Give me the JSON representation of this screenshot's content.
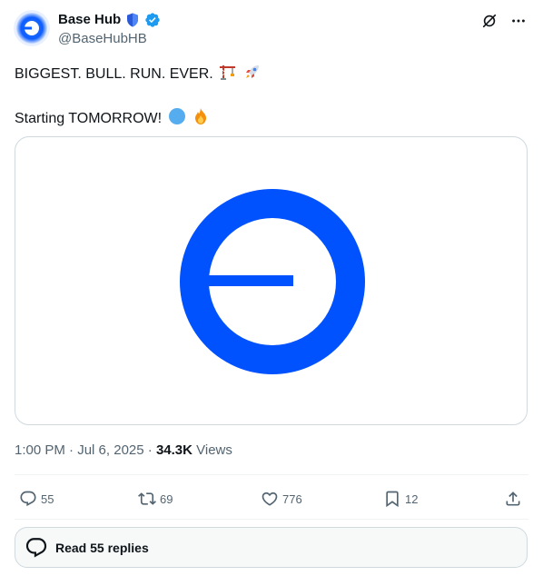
{
  "author": {
    "display_name": "Base Hub",
    "handle": "@BaseHubHB"
  },
  "tweet": {
    "line1": "BIGGEST. BULL. RUN. EVER.",
    "line1_emojis": [
      "crane-emoji",
      "rocket-emoji"
    ],
    "line2": "Starting TOMORROW!",
    "line2_emojis": [
      "blue-circle-emoji",
      "fire-emoji"
    ]
  },
  "meta": {
    "time": "1:00 PM",
    "sep1": " · ",
    "date": "Jul 6, 2025",
    "sep2": " · ",
    "views_count": "34.3K",
    "views_label": " Views"
  },
  "actions": {
    "replies": "55",
    "reposts": "69",
    "likes": "776",
    "bookmarks": "12"
  },
  "read_replies": {
    "label": "Read 55 replies"
  },
  "colors": {
    "brand_blue": "#0052ff",
    "verified_blue": "#1d9bf0",
    "text_secondary": "#536471",
    "border": "#cfd9de"
  },
  "icons": [
    "grok-icon",
    "more-icon",
    "reply-icon",
    "repost-icon",
    "like-icon",
    "bookmark-icon",
    "share-icon",
    "speech-bubble-icon"
  ]
}
